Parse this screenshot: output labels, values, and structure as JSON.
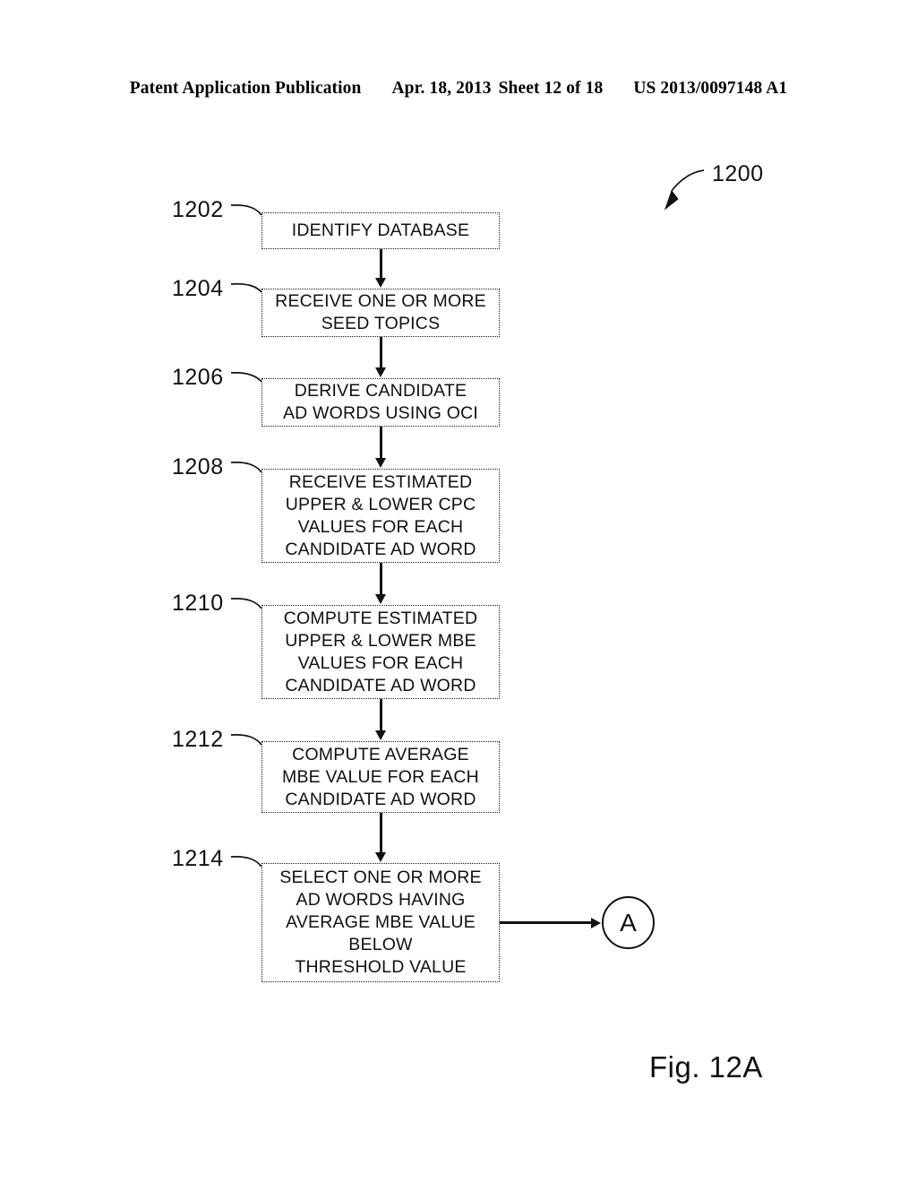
{
  "header": {
    "publication": "Patent Application Publication",
    "date": "Apr. 18, 2013",
    "sheet": "Sheet 12 of 18",
    "patent_number": "US 2013/0097148 A1"
  },
  "figure": {
    "caption": "Fig. 12A",
    "diagram_label": "1200"
  },
  "steps": [
    {
      "ref": "1202",
      "lines": [
        "IDENTIFY DATABASE"
      ]
    },
    {
      "ref": "1204",
      "lines": [
        "RECEIVE ONE OR MORE",
        "SEED TOPICS"
      ]
    },
    {
      "ref": "1206",
      "lines": [
        "DERIVE CANDIDATE",
        "AD WORDS USING OCI"
      ]
    },
    {
      "ref": "1208",
      "lines": [
        "RECEIVE ESTIMATED",
        "UPPER & LOWER CPC",
        "VALUES FOR EACH",
        "CANDIDATE AD WORD"
      ]
    },
    {
      "ref": "1210",
      "lines": [
        "COMPUTE ESTIMATED",
        "UPPER & LOWER MBE",
        "VALUES FOR EACH",
        "CANDIDATE AD WORD"
      ]
    },
    {
      "ref": "1212",
      "lines": [
        "COMPUTE AVERAGE",
        "MBE VALUE FOR EACH",
        "CANDIDATE AD WORD"
      ]
    },
    {
      "ref": "1214",
      "lines": [
        "SELECT ONE OR MORE",
        "AD WORDS HAVING",
        "AVERAGE MBE VALUE",
        "BELOW",
        "THRESHOLD VALUE"
      ]
    }
  ],
  "connector": {
    "label": "A"
  },
  "colors": {
    "ink": "#111111",
    "paper": "#ffffff"
  }
}
